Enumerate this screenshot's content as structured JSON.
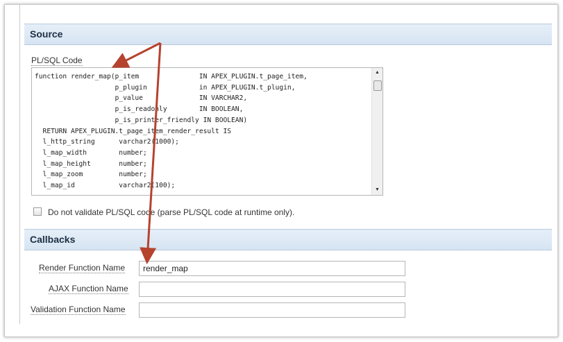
{
  "source": {
    "header": "Source",
    "code_label": "PL/SQL Code",
    "code": "function render_map(p_item               IN APEX_PLUGIN.t_page_item,\n                    p_plugin             in APEX_PLUGIN.t_plugin,\n                    p_value              IN VARCHAR2,\n                    p_is_readonly        IN BOOLEAN,\n                    p_is_printer_friendly IN BOOLEAN)\n  RETURN APEX_PLUGIN.t_page_item_render_result IS\n  l_http_string      varchar2(1000);\n  l_map_width        number;\n  l_map_height       number;\n  l_map_zoom         number;\n  l_map_id           varchar2(100);",
    "scroll_up": "▲",
    "scroll_down": "▼",
    "checkbox_label": "Do not validate PL/SQL code (parse PL/SQL code at runtime only)."
  },
  "callbacks": {
    "header": "Callbacks",
    "render_label": "Render Function Name",
    "render_value": "render_map",
    "ajax_label": "AJAX Function Name",
    "ajax_value": "",
    "validation_label": "Validation Function Name",
    "validation_value": ""
  },
  "colors": {
    "annotation_arrow": "#b5432e",
    "header_bg": "#dde8f4"
  }
}
